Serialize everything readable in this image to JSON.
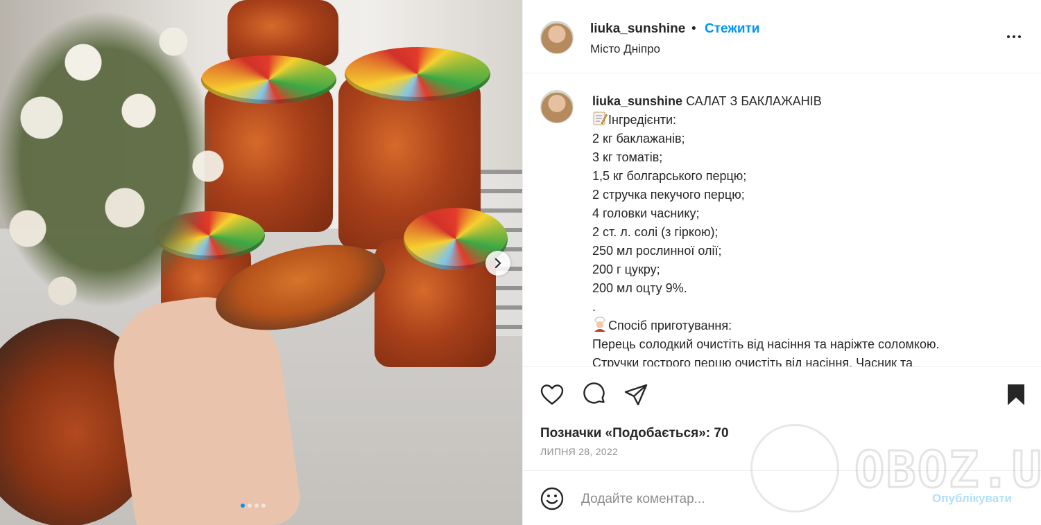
{
  "post": {
    "username": "liuka_sunshine",
    "separator": "•",
    "follow_label": "Стежити",
    "location": "Місто Дніпро",
    "more_icon": "more-horizontal-icon"
  },
  "caption": {
    "username": "liuka_sunshine",
    "title": "САЛАТ З БАКЛАЖАНІВ",
    "ingredients_header": "Інгредієнти:",
    "ingredients": [
      "2 кг баклажанів;",
      "3 кг томатів;",
      "1,5 кг болгарського перцю;",
      "2 стручка пекучого перцю;",
      "4 головки часнику;",
      "2 ст. л. солі (з гіркою);",
      "250 мл рослинної олії;",
      "200 г цукру;",
      "200 мл оцту 9%."
    ],
    "dot_line": ".",
    "method_header": "Спосіб приготування:",
    "method_lines": [
      "Перець солодкий очистіть від насіння та наріжте соломкою.",
      "Стручки гострого перцю очистіть від насіння. Часник та"
    ]
  },
  "actions": {
    "like_icon": "heart-icon",
    "comment_icon": "comment-icon",
    "share_icon": "share-icon",
    "save_icon": "bookmark-icon",
    "likes_text": "Позначки «Подобається»: 70",
    "date": "ЛИПНЯ 28, 2022"
  },
  "comment": {
    "placeholder": "Додайте коментар...",
    "publish_label": "Опублікувати"
  },
  "carousel": {
    "total_slides": 4,
    "active_slide": 1
  },
  "watermark": {
    "text": "OBOZ.UA"
  },
  "colors": {
    "accent": "#0095f6",
    "publish_disabled": "#b2dffc",
    "secondary_text": "#8e8e8e",
    "border": "#efefef"
  }
}
